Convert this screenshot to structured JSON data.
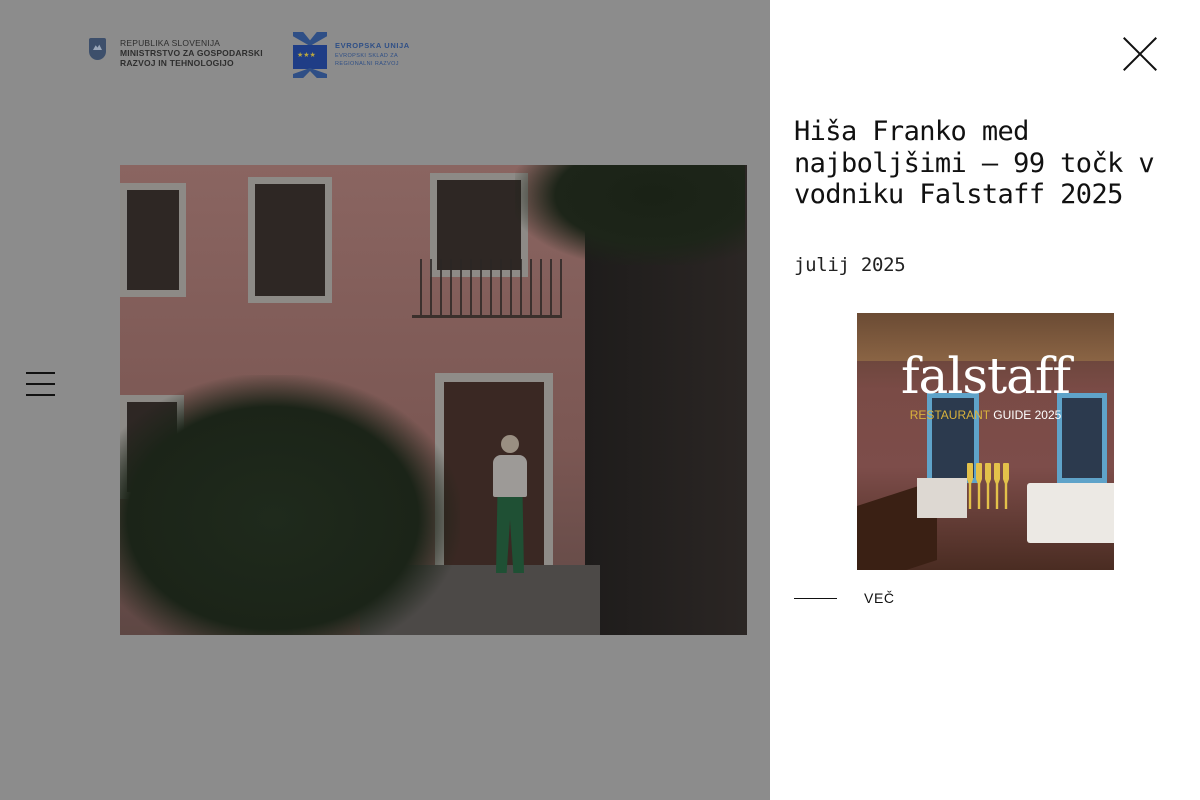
{
  "logos": {
    "gov": {
      "line1": "REPUBLIKA SLOVENIJA",
      "line2": "MINISTRSTVO ZA GOSPODARSKI",
      "line3": "RAZVOJ IN TEHNOLOGIJO"
    },
    "eu": {
      "line1": "EVROPSKA UNIJA",
      "line2": "EVROPSKI SKLAD ZA",
      "line3": "REGIONALNI RAZVOJ"
    }
  },
  "article": {
    "title": "Hiša Franko med najboljšimi – 99 točk v vodniku Falstaff 2025",
    "date": "julij 2025",
    "thumbnail": {
      "brand": "falstaff",
      "guide_part1": "RESTAURANT",
      "guide_part2": "GUIDE 2025"
    },
    "more_label": "VEČ"
  },
  "icons": {
    "menu": "hamburger-menu-icon",
    "close": "close-icon"
  },
  "colors": {
    "overlay": "#8c8c8c",
    "panel": "#ffffff",
    "text": "#111111",
    "falstaff_gold": "#d9b23c"
  }
}
